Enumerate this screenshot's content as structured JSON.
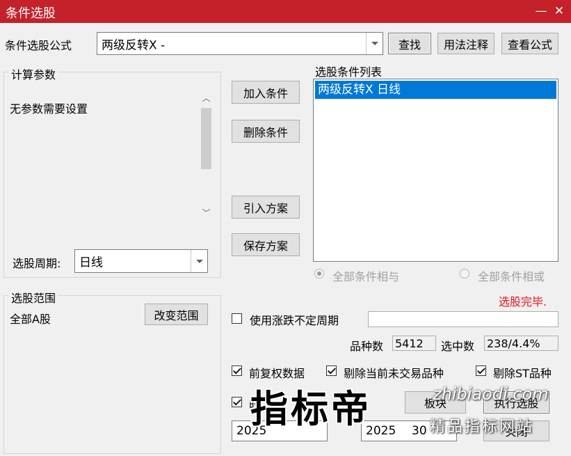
{
  "window": {
    "title": "条件选股",
    "minimize": "—",
    "close": "✕"
  },
  "formula": {
    "label": "条件选股公式",
    "value": "两级反转X  -",
    "find": "查找",
    "usage": "用法注释",
    "view": "查看公式"
  },
  "params": {
    "group": "计算参数",
    "text": "无参数需要设置",
    "period_label": "选股周期:",
    "period_value": "日线"
  },
  "buttons": {
    "add": "加入条件",
    "remove": "删除条件",
    "import": "引入方案",
    "save": "保存方案"
  },
  "cond_list": {
    "label": "选股条件列表",
    "items": [
      "两级反转X  日线"
    ]
  },
  "logic": {
    "and": "全部条件相与",
    "or": "全部条件相或",
    "and_selected": true
  },
  "status": {
    "done": "选股完毕."
  },
  "range": {
    "group": "选股范围",
    "value": "全部A股",
    "change": "改变范围"
  },
  "options": {
    "indeterminate_period": "使用涨跌不定周期",
    "adjusted": "前复权数据",
    "exclude_untraded": "剔除当前未交易品种",
    "exclude_st": "剔除ST品种",
    "time_range": "时",
    "target_board": "板块",
    "execute": "执行选股",
    "close": "关闭"
  },
  "counts": {
    "variety_label": "品种数",
    "variety": "5412",
    "selected_label": "选中数",
    "selected": "238/4.4%"
  },
  "dates": {
    "start": "2025",
    "end": "2025",
    "end_tail": "30"
  },
  "watermark": {
    "brand": "指标帝",
    "url": "zhibiaodi.com",
    "slogan": "精品指标网站"
  },
  "colors": {
    "title_bar": "#c4212b",
    "selection": "#0078d7",
    "status_text": "#e8141c"
  }
}
